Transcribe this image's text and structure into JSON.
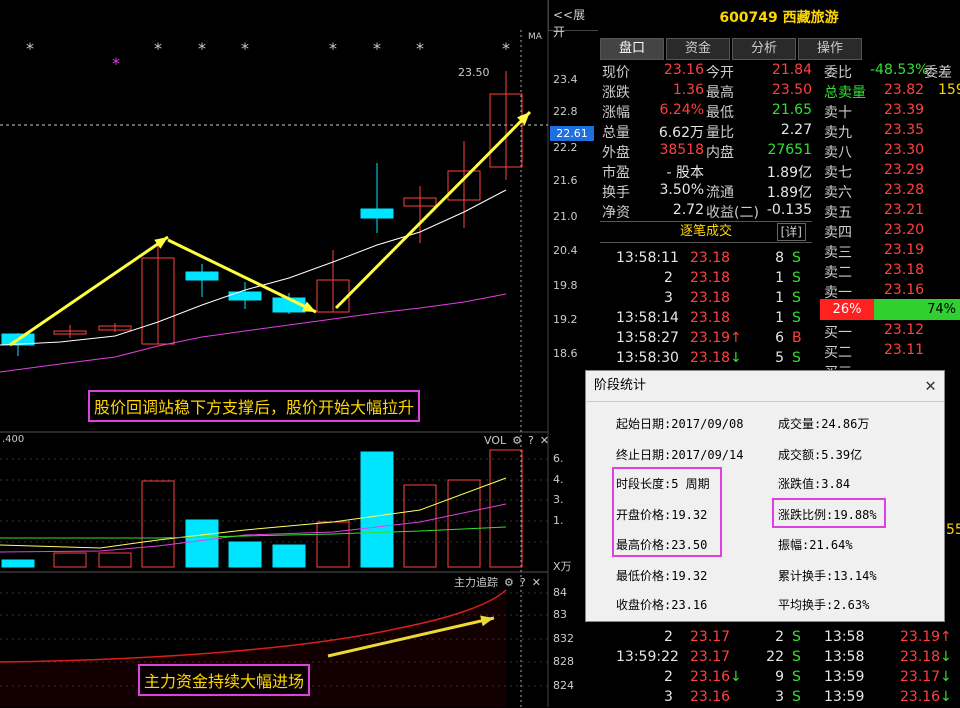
{
  "header": {
    "expand_label": "<<展开",
    "ma_label": "MA",
    "stock_title": "600749 西藏旅游"
  },
  "price_axis": {
    "ticks": [
      "23.4",
      "22.8",
      "22.2",
      "21.6",
      "21.0",
      "20.4",
      "19.8",
      "19.2",
      "18.6"
    ],
    "current_tag": "22.61",
    "high_label": "23.50"
  },
  "vol_axis": {
    "ticks": [
      "6.",
      "4.",
      "3.",
      "1."
    ],
    "unit": "X万",
    "left_value": ".400"
  },
  "main_axis": {
    "ticks": [
      "84",
      "83",
      "832",
      "828",
      "824"
    ]
  },
  "annotations": {
    "price_note": "股价回调站稳下方支撑后，股价开始大幅拉升",
    "fund_note": "主力资金持续大幅进场"
  },
  "panels": {
    "vol_label": "VOL",
    "main_label": "主力追踪",
    "gear": "⚙",
    "help": "?",
    "close": "✕"
  },
  "tabs": [
    "盘口",
    "资金",
    "分析",
    "操作"
  ],
  "quote": {
    "rows": [
      {
        "l1": "现价",
        "v1": "23.16",
        "l2": "今开",
        "v2": "21.84"
      },
      {
        "l1": "涨跌",
        "v1": "1.36",
        "l2": "最高",
        "v2": "23.50"
      },
      {
        "l1": "涨幅",
        "v1": "6.24%",
        "l2": "最低",
        "v2": "21.65"
      },
      {
        "l1": "总量",
        "v1": "6.62万",
        "l2": "量比",
        "v2": "2.27"
      },
      {
        "l1": "外盘",
        "v1": "38518",
        "l2": "内盘",
        "v2": "27651"
      },
      {
        "l1": "市盈",
        "v1": "- 股本",
        "l2": "",
        "v2": "1.89亿"
      },
      {
        "l1": "换手",
        "v1": "3.50%",
        "l2": "流通",
        "v2": "1.89亿"
      },
      {
        "l1": "净资",
        "v1": "2.72",
        "l2": "收益(二)",
        "v2": "-0.135"
      }
    ]
  },
  "trades_header": "逐笔成交",
  "trades_detail": "[详]",
  "trades": [
    {
      "t": "13:58:11",
      "p": "23.18",
      "a": "",
      "v": "8",
      "s": "S"
    },
    {
      "t": "",
      "p": "23.18",
      "a": "",
      "v": "1",
      "s": "S",
      "n": "2"
    },
    {
      "t": "",
      "p": "23.18",
      "a": "",
      "v": "1",
      "s": "S",
      "n": "3"
    },
    {
      "t": "13:58:14",
      "p": "23.18",
      "a": "",
      "v": "1",
      "s": "S"
    },
    {
      "t": "13:58:27",
      "p": "23.19",
      "a": "↑",
      "v": "6",
      "s": "B"
    },
    {
      "t": "13:58:30",
      "p": "23.18",
      "a": "↓",
      "v": "5",
      "s": "S"
    }
  ],
  "trades_bottom": [
    {
      "t": "",
      "n": "2",
      "p": "23.17",
      "v": "2",
      "s": "S"
    },
    {
      "t": "13:59:22",
      "n": "",
      "p": "23.17",
      "v": "22",
      "s": "S"
    },
    {
      "t": "",
      "n": "2",
      "p": "23.16",
      "v": "9",
      "s": "S",
      "a": "↓"
    },
    {
      "t": "",
      "n": "3",
      "p": "23.16",
      "v": "3",
      "s": "S"
    }
  ],
  "order_book": {
    "wei_bi_label": "委比",
    "wei_bi": "-48.53%",
    "wei_cha_label": "委差",
    "total_sell_label": "总卖量",
    "total_sell": "23.82",
    "total_sell_extra": "159",
    "sells": [
      {
        "l": "卖十",
        "p": "23.39"
      },
      {
        "l": "卖九",
        "p": "23.35"
      },
      {
        "l": "卖八",
        "p": "23.30"
      },
      {
        "l": "卖七",
        "p": "23.29"
      },
      {
        "l": "卖六",
        "p": "23.28"
      },
      {
        "l": "卖五",
        "p": "23.21"
      },
      {
        "l": "卖四",
        "p": "23.20"
      },
      {
        "l": "卖三",
        "p": "23.19"
      },
      {
        "l": "卖二",
        "p": "23.18"
      },
      {
        "l": "卖一",
        "p": "23.16"
      }
    ],
    "ratio_red": "26%",
    "ratio_green": "74%",
    "buys": [
      {
        "l": "买一",
        "p": "23.12"
      },
      {
        "l": "买二",
        "p": "23.11"
      },
      {
        "l": "买三",
        "p": ""
      }
    ],
    "extra_right": "55"
  },
  "right_bottom": [
    {
      "t": "13:58",
      "p": "23.19",
      "a": "↑"
    },
    {
      "t": "13:58",
      "p": "23.18",
      "a": "↓"
    },
    {
      "t": "13:59",
      "p": "23.17",
      "a": "↓"
    },
    {
      "t": "13:59",
      "p": "23.16",
      "a": "↓"
    }
  ],
  "dialog": {
    "title": "阶段统计",
    "start_date": "起始日期:2017/09/08",
    "volume": "成交量:24.86万",
    "end_date": "终止日期:2017/09/14",
    "amount": "成交额:5.39亿",
    "period": "时段长度:5 周期",
    "change_val": "涨跌值:3.84",
    "open": "开盘价格:19.32",
    "change_pct": "涨跌比例:19.88%",
    "high": "最高价格:23.50",
    "amplitude": "振幅:21.64%",
    "low": "最低价格:19.32",
    "cum_turnover": "累计换手:13.14%",
    "close": "收盘价格:23.16",
    "avg_turnover": "平均换手:2.63%"
  },
  "colors": {
    "up": "#ff4040",
    "down": "#00e5ff",
    "ma5": "#ffffff",
    "ma_long": "#e040e0",
    "arrow": "#ffff40",
    "fund_line": "#e02020"
  }
}
